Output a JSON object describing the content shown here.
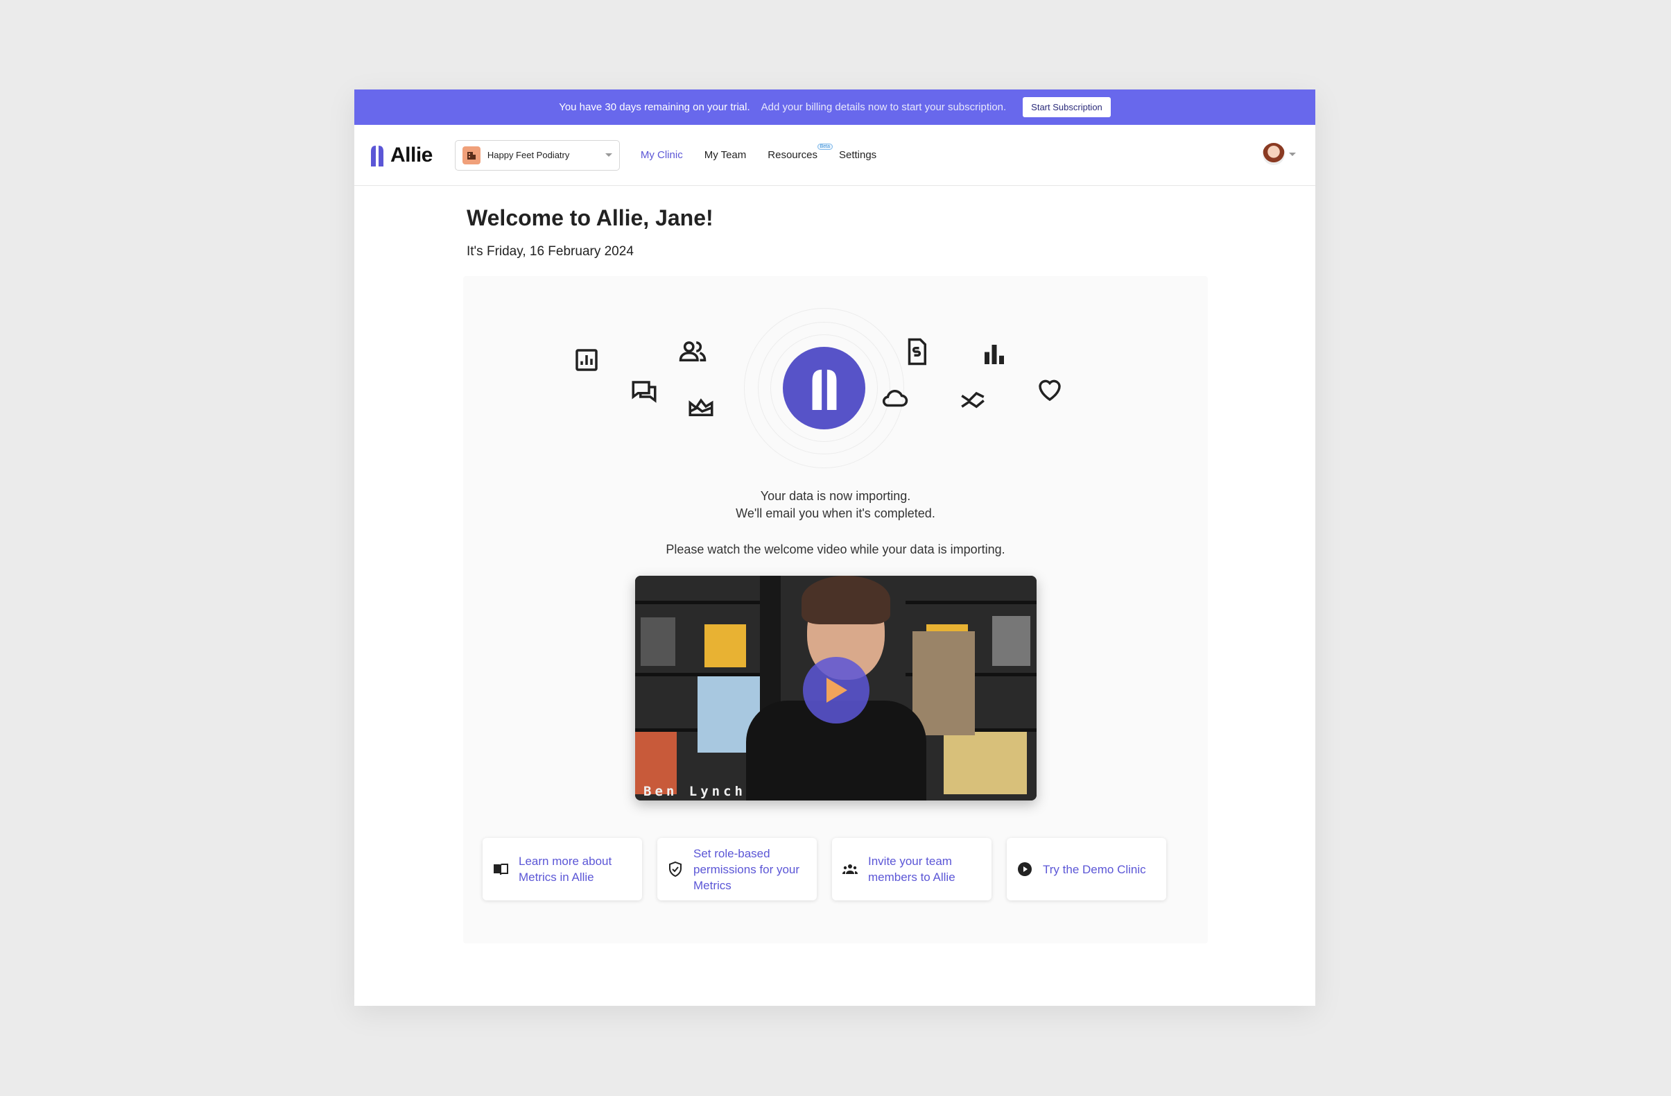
{
  "banner": {
    "trial_text": "You have 30 days remaining on your trial.",
    "billing_text": "Add your billing details now to start your subscription.",
    "button_label": "Start Subscription",
    "color": "#6868ec"
  },
  "nav": {
    "logo_text": "Allie",
    "clinic_name": "Happy Feet Podiatry",
    "items": [
      {
        "label": "My Clinic",
        "active": true
      },
      {
        "label": "My Team"
      },
      {
        "label": "Resources",
        "badge": "Beta"
      },
      {
        "label": "Settings"
      }
    ],
    "accent": "#5b56d6"
  },
  "main": {
    "welcome": "Welcome to Allie, Jane!",
    "date": "It's Friday, 16 February 2024",
    "import_line1": "Your data is now importing.",
    "import_line2": "We'll email you when it's completed.",
    "video_prompt": "Please watch the welcome video while your data is importing.",
    "video_caption": "Ben Lynch",
    "hero_icons": [
      "report-icon",
      "chat-icon",
      "people-icon",
      "landscape-icon",
      "invoice-icon",
      "cloud-icon",
      "bar-chart-icon",
      "trend-icon",
      "heart-icon"
    ]
  },
  "cards": [
    {
      "label": "Learn more about Metrics in Allie",
      "icon": "book-icon"
    },
    {
      "label": "Set role-based permissions for your Metrics",
      "icon": "shield-check-icon"
    },
    {
      "label": "Invite your team members to Allie",
      "icon": "group-icon"
    },
    {
      "label": "Try the Demo Clinic",
      "icon": "play-circle-icon"
    }
  ]
}
